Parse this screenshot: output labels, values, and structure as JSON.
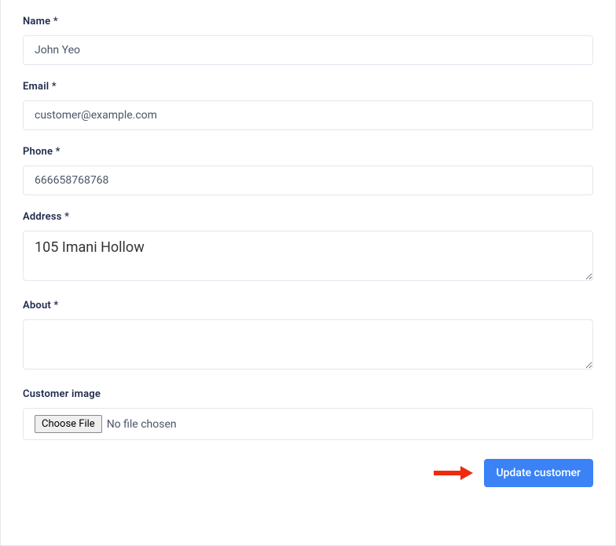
{
  "form": {
    "name": {
      "label": "Name *",
      "value": "John Yeo"
    },
    "email": {
      "label": "Email *",
      "value": "customer@example.com"
    },
    "phone": {
      "label": "Phone *",
      "value": "666658768768"
    },
    "address": {
      "label": "Address *",
      "value": "105 Imani Hollow"
    },
    "about": {
      "label": "About *",
      "value": ""
    },
    "customer_image": {
      "label": "Customer image",
      "button_label": "Choose File",
      "status_text": "No file chosen"
    },
    "submit_label": "Update customer"
  }
}
